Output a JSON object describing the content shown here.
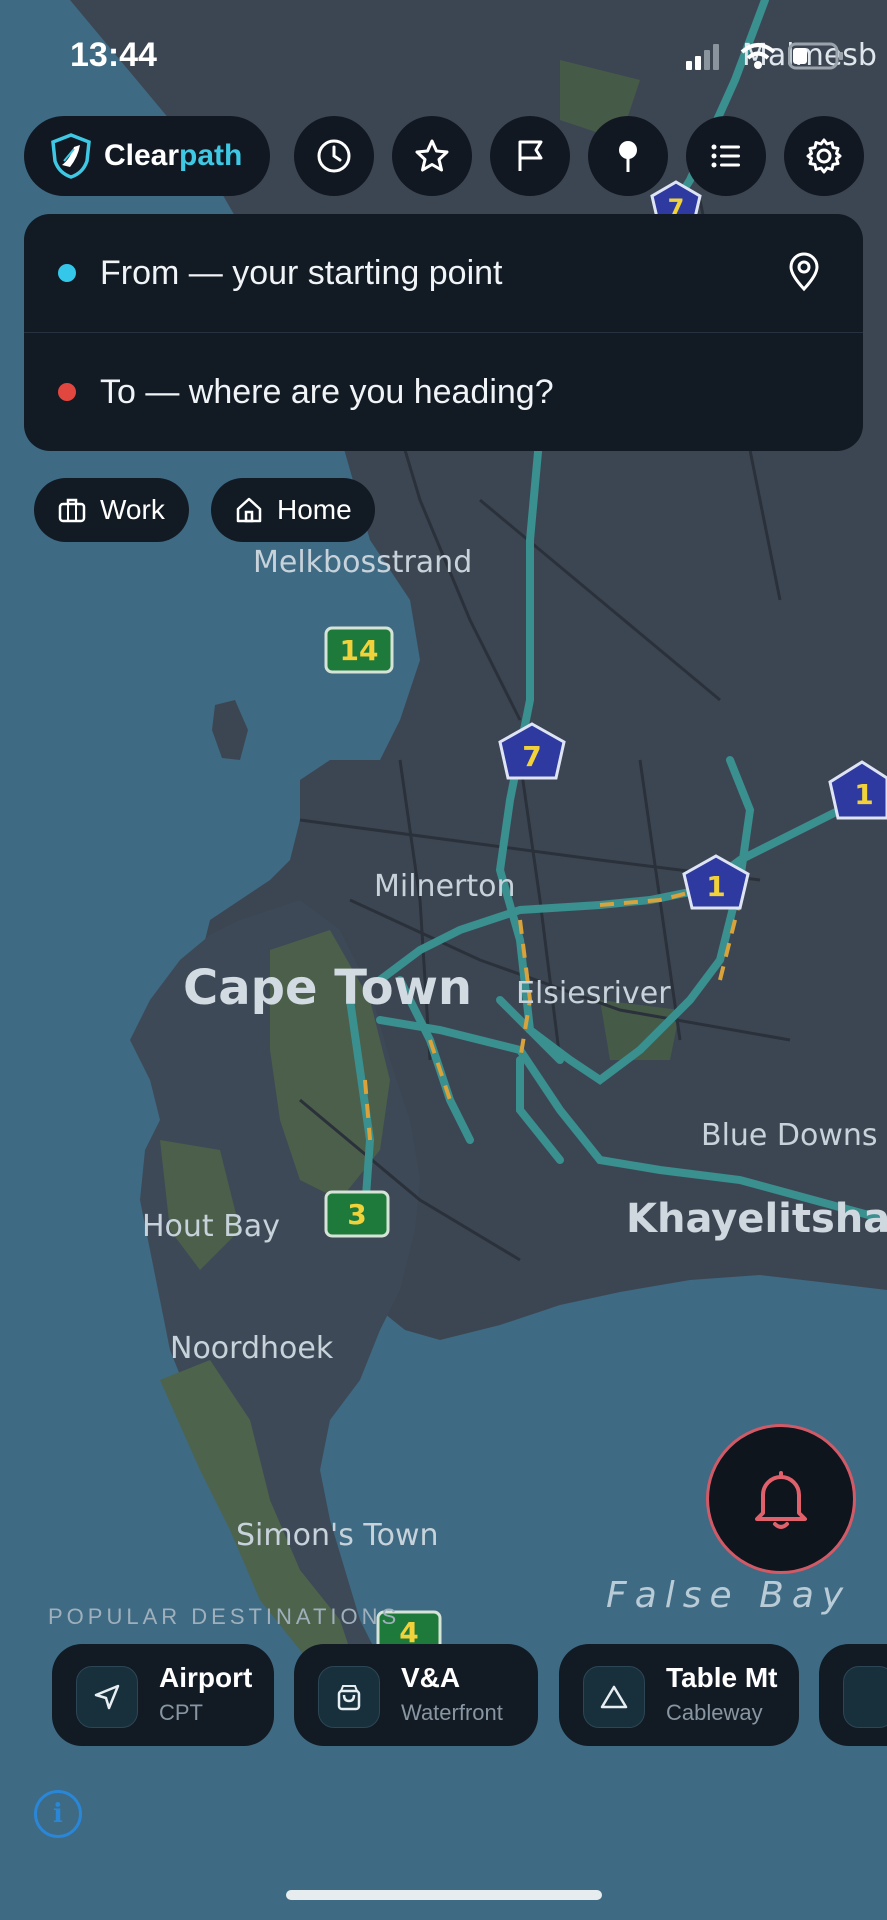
{
  "status": {
    "time": "13:44",
    "top_right_label": "Malmesb"
  },
  "app": {
    "name_part1": "Clear",
    "name_part2": "path"
  },
  "toolbar": {
    "icons": [
      "history-icon",
      "star-icon",
      "flag-icon",
      "pin-icon",
      "list-icon",
      "gear-icon"
    ]
  },
  "search": {
    "from_placeholder": "From — your starting point",
    "to_placeholder": "To — where are you heading?"
  },
  "quick": {
    "work": "Work",
    "home": "Home"
  },
  "map": {
    "labels": {
      "melkbosstrand": "Melkbosstrand",
      "milnerton": "Milnerton",
      "cape_town": "Cape Town",
      "elsiesriver": "Elsiesriver",
      "blue_downs": "Blue Downs",
      "khayelitsha": "Khayelitsha",
      "hout_bay": "Hout Bay",
      "noordhoek": "Noordhoek",
      "simons_town": "Simon's Town",
      "false_bay": "False Bay"
    },
    "shields": {
      "r14": "14",
      "n7a": "7",
      "n7b": "7",
      "n1a": "1",
      "n1b": "1",
      "m3": "3",
      "m4": "4"
    }
  },
  "popular": {
    "label": "POPULAR DESTINATIONS",
    "items": [
      {
        "title": "Airport",
        "subtitle": "CPT",
        "icon": "navigation-arrow-icon"
      },
      {
        "title": "V&A",
        "subtitle": "Waterfront",
        "icon": "shopping-bag-icon"
      },
      {
        "title": "Table Mt",
        "subtitle": "Cableway",
        "icon": "mountain-triangle-icon"
      }
    ]
  },
  "colors": {
    "accent": "#3ec8e4",
    "from_dot": "#35c7ea",
    "to_dot": "#e2473f",
    "alert": "#e0606c"
  }
}
